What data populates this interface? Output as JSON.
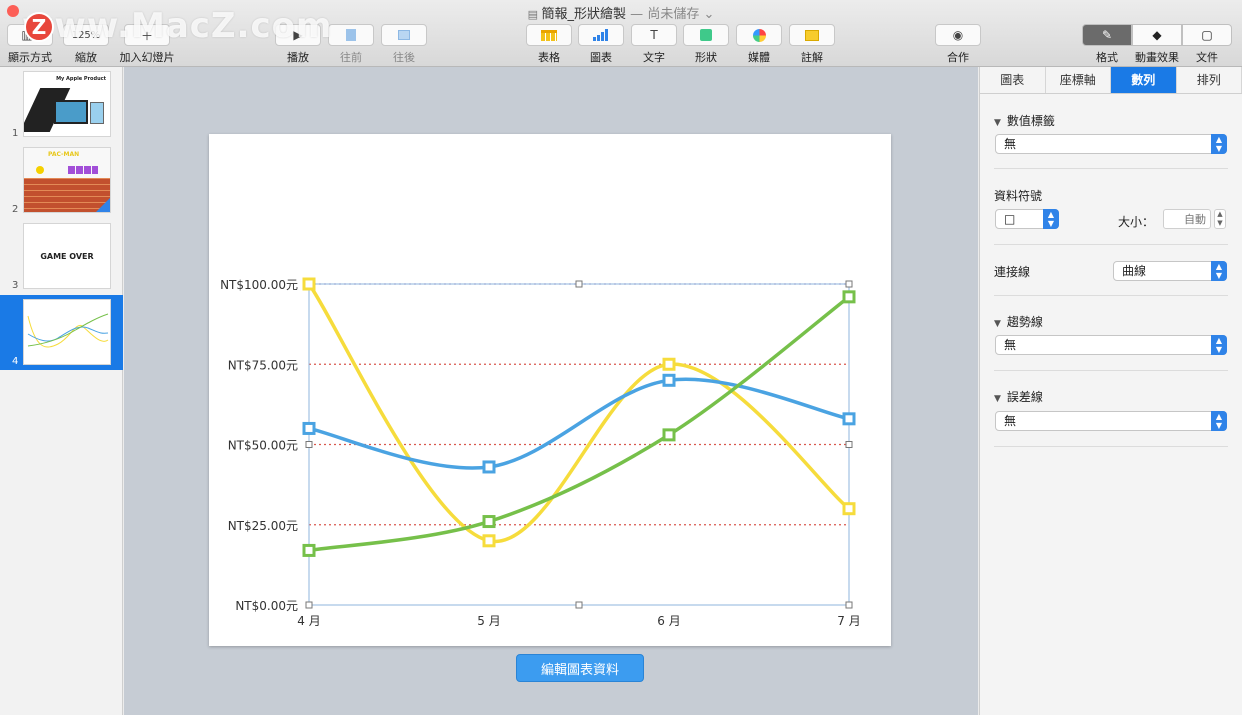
{
  "window": {
    "title": "簡報_形狀繪製",
    "title_sep": " — ",
    "status": "尚未儲存"
  },
  "watermark": {
    "badge": "Z",
    "text": "www.MacZ.com"
  },
  "toolbar": {
    "view": {
      "label": "顯示方式",
      "icon": "view-icon"
    },
    "zoom": {
      "label": "縮放",
      "value": "125%",
      "icon": "zoom-icon"
    },
    "add_slide": {
      "label": "加入幻燈片",
      "icon": "plus-icon"
    },
    "play": {
      "label": "播放",
      "glyph": "▶"
    },
    "forward": {
      "label": "往前"
    },
    "backward": {
      "label": "往後"
    },
    "table": {
      "label": "表格"
    },
    "chart": {
      "label": "圖表"
    },
    "text": {
      "label": "文字",
      "glyph": "T"
    },
    "shape": {
      "label": "形狀"
    },
    "media": {
      "label": "媒體"
    },
    "comment": {
      "label": "註解"
    },
    "collaborate": {
      "label": "合作"
    },
    "format": {
      "label": "格式"
    },
    "animate": {
      "label": "動畫效果"
    },
    "document": {
      "label": "文件"
    }
  },
  "slides": [
    {
      "number": "1",
      "title": "My Apple Product"
    },
    {
      "number": "2",
      "title": "PAC-MAN"
    },
    {
      "number": "3",
      "title": "GAME OVER"
    },
    {
      "number": "4",
      "title": ""
    }
  ],
  "chart_data": {
    "type": "line",
    "categories": [
      "4 月",
      "5 月",
      "6 月",
      "7 月"
    ],
    "series": [
      {
        "color": "#f6dc3c",
        "values": [
          100,
          20,
          75,
          30
        ]
      },
      {
        "color": "#4aa3e2",
        "values": [
          55,
          43,
          70,
          58
        ]
      },
      {
        "color": "#76c04a",
        "values": [
          17,
          26,
          53,
          96
        ]
      }
    ],
    "y_ticks": [
      "NT$0.00元",
      "NT$25.00元",
      "NT$50.00元",
      "NT$75.00元",
      "NT$100.00元"
    ],
    "ylim": [
      0,
      100
    ],
    "grid": true,
    "grid_color": "#d9584e",
    "line_style": "curved",
    "marker": "square"
  },
  "edit_chart_button": "編輯圖表資料",
  "inspector": {
    "tabs": [
      "圖表",
      "座標軸",
      "數列",
      "排列"
    ],
    "active_tab": "數列",
    "value_labels": {
      "heading": "數值標籤",
      "value": "無"
    },
    "data_symbol": {
      "heading": "資料符號",
      "value": "□",
      "size_label": "大小：",
      "size_placeholder": "自動"
    },
    "connect_lines": {
      "heading": "連接線",
      "value": "曲線"
    },
    "trendline": {
      "heading": "趨勢線",
      "value": "無"
    },
    "error_bars": {
      "heading": "誤差線",
      "value": "無"
    },
    "accent": "#1a7ae6"
  }
}
